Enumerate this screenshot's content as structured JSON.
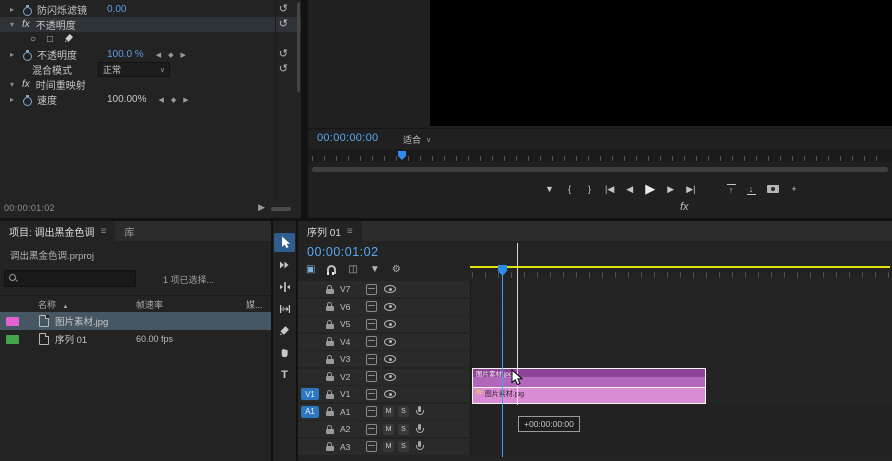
{
  "colors": {
    "accent_blue": "#2d8ceb",
    "timecode_blue": "#59a9f2",
    "hot_value_blue": "#5f9be6",
    "workarea_yellow": "#e2e20b",
    "clip_v2_body": "#b268ba",
    "clip_v2_header": "#8d4396",
    "clip_v1_body": "#d98bd4",
    "track_box_blue": "#2d76c0",
    "selected_row": "#475663"
  },
  "icons": {
    "chevron_right": "▸",
    "chevron_down": "▾",
    "reset": "↺",
    "kf_prev": "◀",
    "kf_add": "◆",
    "kf_next": "▶",
    "caret_down": "∨",
    "mask_ellipse": "○",
    "mask_rect": "□",
    "add_marker": "▼",
    "mark_in": "{",
    "mark_out": "}",
    "go_to_in": "|◀",
    "step_back": "◀",
    "play": "▶",
    "step_forward": "▶",
    "go_to_out": "▶|",
    "lift": "↑",
    "extract": "↓",
    "plus": "+",
    "panel_menu": "≡",
    "sort_asc": "▲",
    "nest": "▣",
    "linked_selection": "◫",
    "timeline_marker": "▼",
    "settings_wrench": "⚙",
    "type_tool": "T",
    "small_play": "▶"
  },
  "effect_controls": {
    "antiflicker": {
      "label": "防闪烁滤镜",
      "value": "0.00"
    },
    "opacity_group": {
      "fx": "fx",
      "label": "不透明度"
    },
    "opacity": {
      "label": "不透明度",
      "value": "100.0 %"
    },
    "blend": {
      "label": "混合模式",
      "value": "正常"
    },
    "time_remap": {
      "fx": "fx",
      "label": "时间重映射"
    },
    "speed": {
      "label": "速度",
      "value": "100.00%"
    },
    "timecode": "00:00:01:02"
  },
  "program_monitor": {
    "timecode": "00:00:00:00",
    "fit_select": {
      "label": "适合"
    },
    "fx_label": "fx"
  },
  "project_panel": {
    "tabs": {
      "project": "项目: 调出黑金色调",
      "library": "库"
    },
    "filename": "调出黑金色调.prproj",
    "selection_info": "1 项已选择...",
    "columns": {
      "name": "名称",
      "framerate": "帧速率",
      "media": "媒..."
    },
    "items": [
      {
        "name": "图片素材.jpg",
        "framerate": "",
        "label_color": "#e361d1"
      },
      {
        "name": "序列 01",
        "framerate": "60.00 fps",
        "label_color": "#43a34a"
      }
    ]
  },
  "timeline": {
    "tab": {
      "label": "序列 01"
    },
    "timecode": "00:00:01:02",
    "video_tracks": [
      "V7",
      "V6",
      "V5",
      "V4",
      "V3",
      "V2",
      "V1"
    ],
    "audio_tracks": [
      "A1",
      "A2",
      "A3"
    ],
    "source_video": "V1",
    "source_audio": "A1",
    "mute": "M",
    "solo": "S",
    "clips": {
      "v2": {
        "name": "图片素材.jpg"
      },
      "v1": {
        "name": "图片素材.jpg",
        "fx_badge": "fx"
      }
    },
    "drag_tooltip": "+00:00:00:00"
  }
}
